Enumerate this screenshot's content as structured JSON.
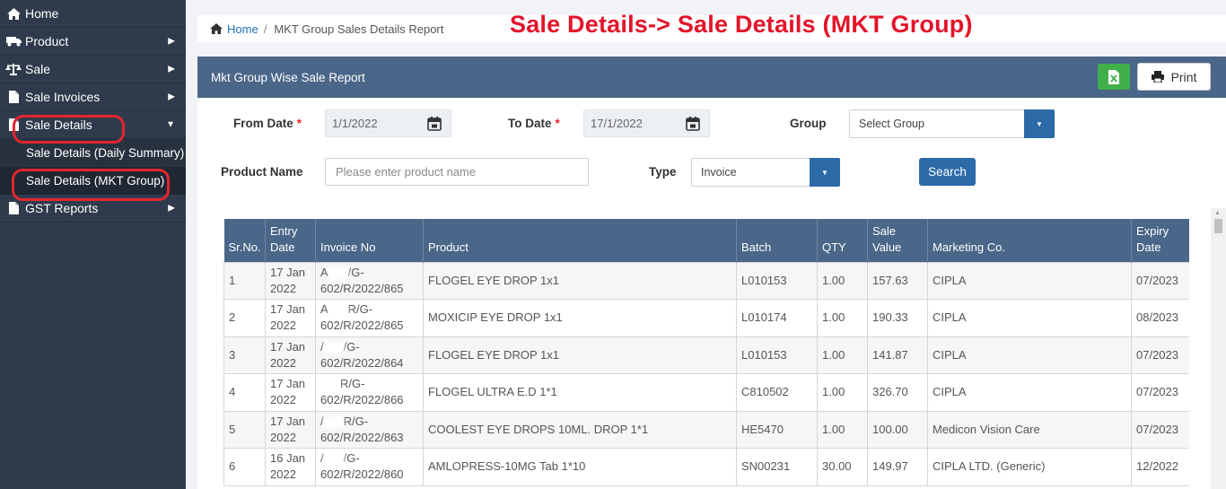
{
  "sidebar": {
    "items": [
      {
        "label": "Home",
        "icon": "home-icon",
        "chevron": false
      },
      {
        "label": "Product",
        "icon": "truck-icon",
        "chevron": true
      },
      {
        "label": "Sale",
        "icon": "balance-scale-icon",
        "chevron": true
      },
      {
        "label": "Sale Invoices",
        "icon": "file-icon",
        "chevron": true
      },
      {
        "label": "Sale Details",
        "icon": "file-icon",
        "chevron": "down"
      }
    ],
    "sub_items": [
      {
        "label": "Sale Details (Daily Summary)"
      },
      {
        "label": "Sale Details (MKT Group)"
      }
    ],
    "after_items": [
      {
        "label": "GST Reports",
        "icon": "file-icon",
        "chevron": true
      }
    ]
  },
  "breadcrumb": {
    "home": "Home",
    "separator": "/",
    "current": "MKT Group Sales Details Report"
  },
  "annotation_title": "Sale Details-> Sale Details (MKT Group)",
  "panel": {
    "title": "Mkt Group Wise Sale Report",
    "print_label": "Print"
  },
  "filters": {
    "from_date_label": "From Date",
    "from_date_value": "1/1/2022",
    "to_date_label": "To Date",
    "to_date_value": "17/1/2022",
    "required_mark": "*",
    "group_label": "Group",
    "group_value": "Select Group",
    "product_name_label": "Product Name",
    "product_name_placeholder": "Please enter product name",
    "type_label": "Type",
    "type_value": "Invoice",
    "search_label": "Search"
  },
  "table": {
    "headers": [
      "Sr.No.",
      "Entry Date",
      "Invoice No",
      "Product",
      "Batch",
      "QTY",
      "Sale Value",
      "Marketing Co.",
      "Expiry Date"
    ],
    "rows": [
      {
        "sr": "1",
        "date1": "17 Jan",
        "date2": "2022",
        "inv1a": "A",
        "inv1b": "/G-",
        "inv2": "602/R/2022/865",
        "product": "FLOGEL EYE DROP 1x1",
        "batch": "L010153",
        "qty": "1.00",
        "value": "157.63",
        "mkt": "CIPLA",
        "expiry": "07/2023"
      },
      {
        "sr": "2",
        "date1": "17 Jan",
        "date2": "2022",
        "inv1a": "A",
        "inv1b": "R/G-",
        "inv2": "602/R/2022/865",
        "product": "MOXICIP EYE DROP 1x1",
        "batch": "L010174",
        "qty": "1.00",
        "value": "190.33",
        "mkt": "CIPLA",
        "expiry": "08/2023"
      },
      {
        "sr": "3",
        "date1": "17 Jan",
        "date2": "2022",
        "inv1a": "/",
        "inv1b": "/G-",
        "inv2": "602/R/2022/864",
        "product": "FLOGEL EYE DROP 1x1",
        "batch": "L010153",
        "qty": "1.00",
        "value": "141.87",
        "mkt": "CIPLA",
        "expiry": "07/2023"
      },
      {
        "sr": "4",
        "date1": "17 Jan",
        "date2": "2022",
        "inv1a": "",
        "inv1b": "R/G-",
        "inv2": "602/R/2022/866",
        "product": "FLOGEL ULTRA E.D 1*1",
        "batch": "C810502",
        "qty": "1.00",
        "value": "326.70",
        "mkt": "CIPLA",
        "expiry": "07/2023"
      },
      {
        "sr": "5",
        "date1": "17 Jan",
        "date2": "2022",
        "inv1a": "/",
        "inv1b": "R/G-",
        "inv2": "602/R/2022/863",
        "product": "COOLEST EYE DROPS 10ML. DROP 1*1",
        "batch": "HE5470",
        "qty": "1.00",
        "value": "100.00",
        "mkt": "Medicon Vision Care",
        "expiry": "07/2023"
      },
      {
        "sr": "6",
        "date1": "16 Jan",
        "date2": "2022",
        "inv1a": "/",
        "inv1b": "/G-",
        "inv2": "602/R/2022/860",
        "product": "AMLOPRESS-10MG Tab 1*10",
        "batch": "SN00231",
        "qty": "30.00",
        "value": "149.97",
        "mkt": "CIPLA LTD. (Generic)",
        "expiry": "12/2022"
      }
    ]
  },
  "colors": {
    "sidebar_bg": "#2f3b4c",
    "panel_header": "#4a6688",
    "primary_button": "#2c6aa8",
    "excel_green": "#40b14a",
    "annotation_red": "#e3142a"
  }
}
